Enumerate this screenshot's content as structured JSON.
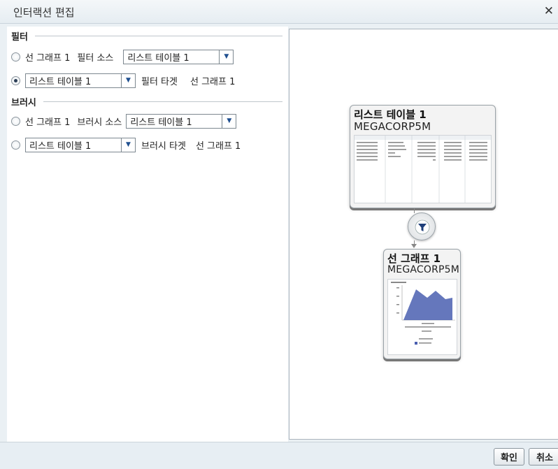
{
  "dialog": {
    "title": "인터랙션 편집",
    "close_icon": "close-icon"
  },
  "filter": {
    "heading": "필터",
    "row1": {
      "source_label": "선 그래프 1",
      "role_label": "필터 소스",
      "select_value": "리스트 테이블 1",
      "selected": false
    },
    "row2": {
      "select_value": "리스트 테이블 1",
      "role_label": "필터 타겟",
      "target_label": "선 그래프 1",
      "selected": true
    }
  },
  "brush": {
    "heading": "브러시",
    "row1": {
      "source_label": "선 그래프 1",
      "role_label": "브러시 소스",
      "select_value": "리스트 테이블 1",
      "selected": false
    },
    "row2": {
      "select_value": "리스트 테이블 1",
      "role_label": "브러시 타겟",
      "target_label": "선 그래프 1",
      "selected": false
    }
  },
  "diagram": {
    "source_card": {
      "title": "리스트 테이블 1",
      "subtitle": "MEGACORP5M"
    },
    "connector_icon": "funnel-icon",
    "target_card": {
      "title": "선 그래프 1",
      "subtitle": "MEGACORP5M"
    }
  },
  "footer": {
    "ok_label": "확인",
    "cancel_label": "취소"
  },
  "colors": {
    "radio_selected": "#2a3d55",
    "chart_fill": "#4a5fb0",
    "select_arrow": "#1f4f8f"
  }
}
